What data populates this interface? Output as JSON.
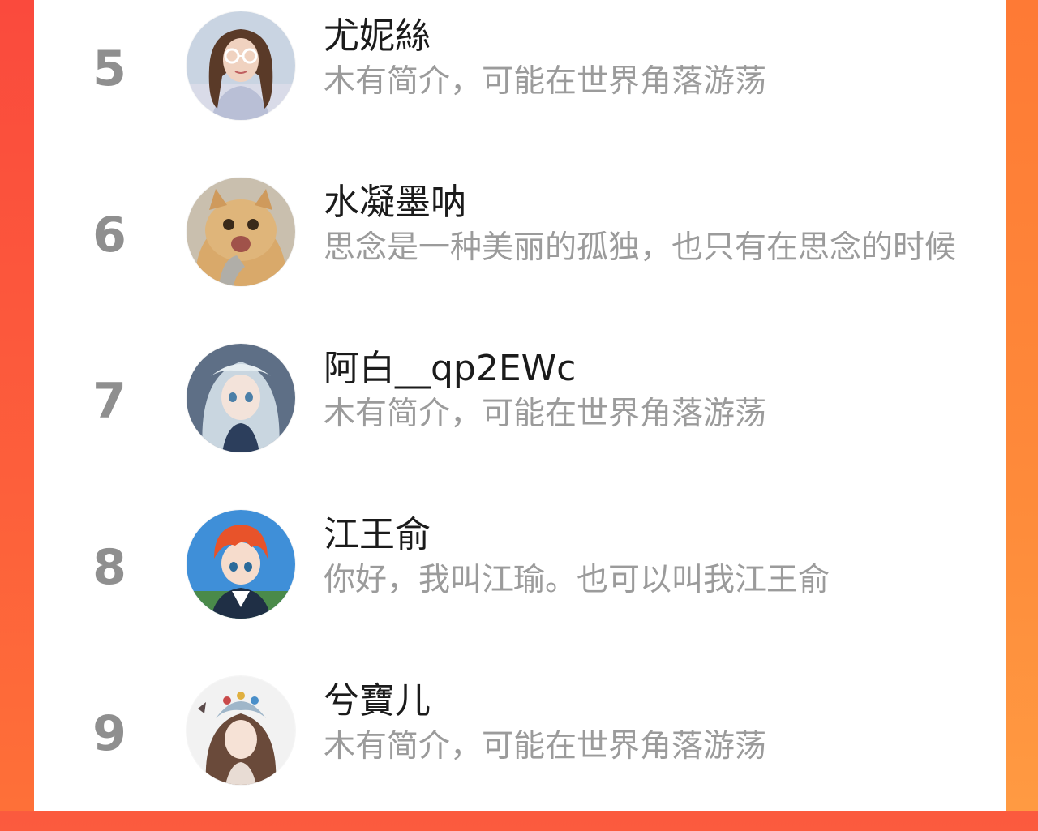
{
  "leaderboard": {
    "entries": [
      {
        "rank": "5",
        "name": "尤妮絲",
        "bio": "木有简介，可能在世界角落游荡",
        "avatar_icon": "girl-with-glasses-avatar"
      },
      {
        "rank": "6",
        "name": "水凝墨呐",
        "bio": "思念是一种美丽的孤独，也只有在思念的时候",
        "avatar_icon": "orange-cat-avatar"
      },
      {
        "rank": "7",
        "name": "阿白__qp2EWc",
        "bio": "木有简介，可能在世界角落游荡",
        "avatar_icon": "anime-girl-blue-hair-avatar"
      },
      {
        "rank": "8",
        "name": "江王俞",
        "bio": "你好，我叫江瑜。也可以叫我江王俞",
        "avatar_icon": "anime-boy-red-hair-avatar"
      },
      {
        "rank": "9",
        "name": "兮寶儿",
        "bio": "木有简介，可能在世界角落游荡",
        "avatar_icon": "anime-girl-headdress-avatar"
      }
    ]
  },
  "colors": {
    "background_left": "#fa4a3d",
    "background_right": "#fe8a38",
    "rank_text": "#8f8f8f",
    "name_text": "#1b1b1b",
    "bio_text": "#9b9b9b"
  }
}
